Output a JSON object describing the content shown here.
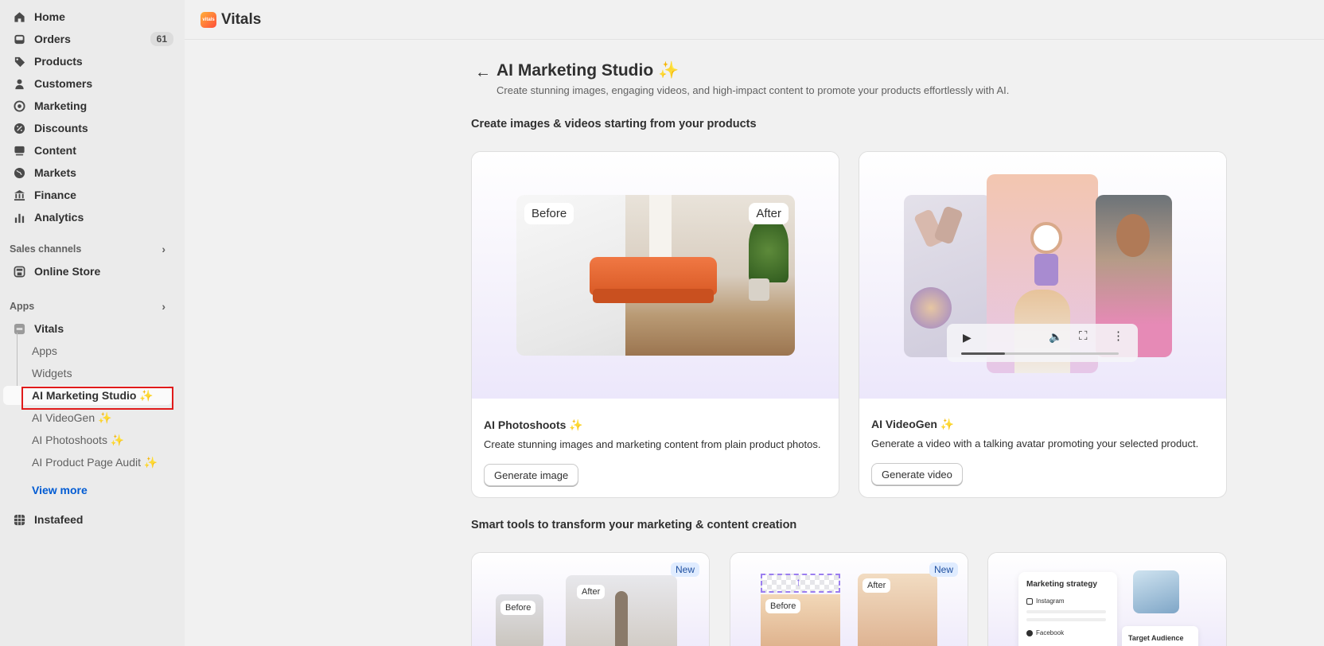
{
  "sidebar": {
    "nav": [
      {
        "label": "Home",
        "icon": "home-icon"
      },
      {
        "label": "Orders",
        "icon": "inbox-icon",
        "badge": "61"
      },
      {
        "label": "Products",
        "icon": "tag-icon"
      },
      {
        "label": "Customers",
        "icon": "person-icon"
      },
      {
        "label": "Marketing",
        "icon": "target-icon"
      },
      {
        "label": "Discounts",
        "icon": "discount-icon"
      },
      {
        "label": "Content",
        "icon": "content-icon"
      },
      {
        "label": "Markets",
        "icon": "globe-icon"
      },
      {
        "label": "Finance",
        "icon": "bank-icon"
      },
      {
        "label": "Analytics",
        "icon": "bar-chart-icon"
      }
    ],
    "sales_channels_title": "Sales channels",
    "online_store": "Online Store",
    "apps_title": "Apps",
    "vitals": "Vitals",
    "sub_items": [
      "Apps",
      "Widgets",
      "AI Marketing Studio ✨",
      "AI VideoGen ✨",
      "AI Photoshoots ✨",
      "AI Product Page Audit ✨"
    ],
    "view_more": "View more",
    "instafeed": "Instafeed"
  },
  "topbar": {
    "app_name": "Vitals",
    "logo_text": "vitals"
  },
  "page": {
    "title": "AI Marketing Studio ✨",
    "subtitle": "Create stunning images, engaging videos, and high-impact content to promote your products effortlessly with AI.",
    "section1": "Create images & videos starting from your products",
    "section2": "Smart tools to transform your marketing & content creation"
  },
  "cards": {
    "photoshoots": {
      "title": "AI Photoshoots ✨",
      "desc": "Create stunning images and marketing content from plain product photos.",
      "button": "Generate image",
      "before": "Before",
      "after": "After"
    },
    "videogen": {
      "title": "AI VideoGen ✨",
      "desc": "Generate a video with a talking avatar promoting your selected product.",
      "button": "Generate video"
    },
    "tool1": {
      "badge": "New",
      "before": "Before",
      "after": "After"
    },
    "tool2": {
      "badge": "New",
      "before": "Before",
      "after": "After"
    },
    "tool3": {
      "strategy": "Marketing strategy",
      "instagram": "Instagram",
      "facebook": "Facebook",
      "audience": "Target Audience"
    }
  },
  "colors": {
    "accent_link": "#005bd3",
    "highlight": "#e01b1b",
    "badge_bg": "#e0ecff"
  }
}
